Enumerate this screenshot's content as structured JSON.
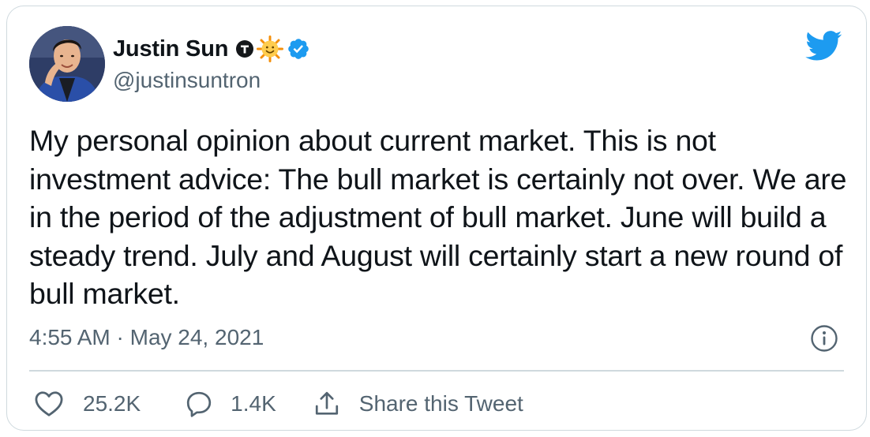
{
  "author": {
    "display_name": "Justin Sun",
    "handle": "@justinsuntron",
    "badges": [
      "tron-icon",
      "sun-emoji-icon",
      "verified-icon"
    ]
  },
  "platform_icon": "twitter-bird-icon",
  "tweet": {
    "text": "My personal opinion about current market. This is not investment advice: The bull market is certainly not over. We are in the period of the adjustment of bull market. June will build a steady trend. July and August will certainly start a new round of bull market.",
    "timestamp": "4:55 AM · May 24, 2021"
  },
  "actions": {
    "likes": "25.2K",
    "replies": "1.4K",
    "share_label": "Share this Tweet"
  },
  "colors": {
    "text": "#0f1419",
    "secondary": "#536471",
    "brand_blue": "#1d9bf0",
    "border": "#cfd9de"
  }
}
